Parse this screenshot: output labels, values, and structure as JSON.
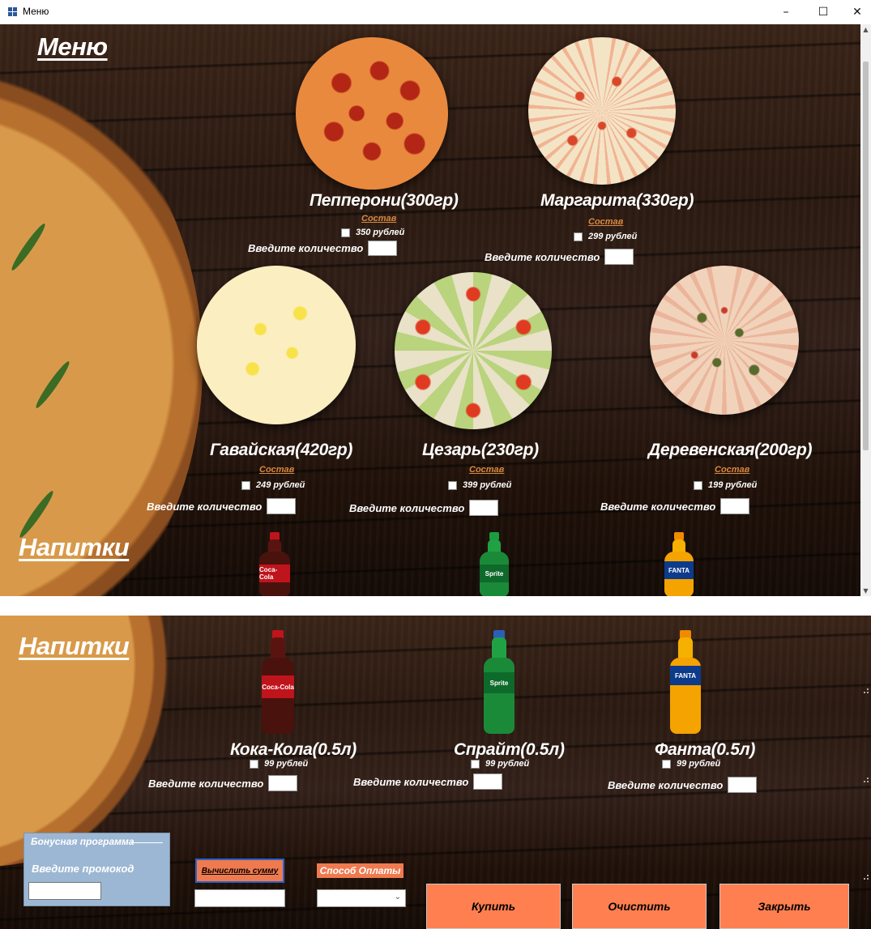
{
  "window": {
    "title": "Меню",
    "minimize_glyph": "–",
    "maximize_glyph": "☐",
    "close_glyph": "✕"
  },
  "menu_section": {
    "title": "Меню"
  },
  "pizzas": [
    {
      "name": "Пепперони(300гр)",
      "composition": "Состав",
      "price": "350 рублей",
      "qty_label": "Введите количество"
    },
    {
      "name": "Маргарита(330гр)",
      "composition": "Состав",
      "price": "299 рублей",
      "qty_label": "Введите количество"
    },
    {
      "name": "Гавайская(420гр)",
      "composition": "Состав",
      "price": "249 рублей",
      "qty_label": "Введите количество"
    },
    {
      "name": "Цезарь(230гр)",
      "composition": "Состав",
      "price": "399 рублей",
      "qty_label": "Введите количество"
    },
    {
      "name": "Деревенская(200гр)",
      "composition": "Состав",
      "price": "199 рублей",
      "qty_label": "Введите количество"
    }
  ],
  "drinks_section": {
    "title": "Напитки"
  },
  "drinks": [
    {
      "name": "Кока-Кола(0.5л)",
      "price": "99 рублей",
      "qty_label": "Введите количество",
      "brand": "Coca-Cola",
      "color": "#b5121b"
    },
    {
      "name": "Спрайт(0.5л)",
      "price": "99 рублей",
      "qty_label": "Введите количество",
      "brand": "Sprite",
      "color": "#1f8f3a"
    },
    {
      "name": "Фанта(0.5л)",
      "price": "99 рублей",
      "qty_label": "Введите количество",
      "brand": "FANTA",
      "color": "#f5a300"
    }
  ],
  "bonus": {
    "legend": "Бонусная программа",
    "promo_label": "Введите промокод"
  },
  "order": {
    "calc_button": "Вычислить сумму",
    "payment_label": "Способ Оплаты",
    "payment_selected": ""
  },
  "actions": {
    "buy": "Купить",
    "clear": "Очистить",
    "close": "Закрыть"
  },
  "colors": {
    "accent": "#ff7f50",
    "composition_link": "#d98840",
    "bonus_box": "#9cb7d3"
  }
}
